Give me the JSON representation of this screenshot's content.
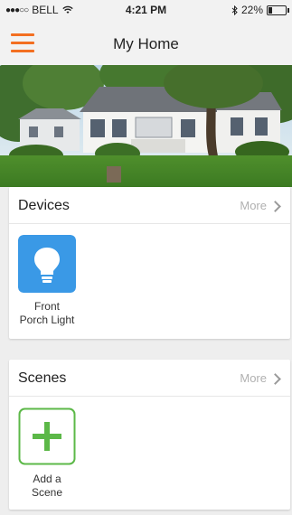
{
  "statusbar": {
    "carrier": "BELL",
    "time": "4:21 PM",
    "battery_text": "22%",
    "battery_level": 0.22
  },
  "navbar": {
    "title": "My Home"
  },
  "devices": {
    "title": "Devices",
    "more_label": "More",
    "items": [
      {
        "label_line1": "Front",
        "label_line2": "Porch Light",
        "icon": "lightbulb-icon",
        "color": "#3a99e6"
      }
    ]
  },
  "scenes": {
    "title": "Scenes",
    "more_label": "More",
    "add_label_line1": "Add a",
    "add_label_line2": "Scene",
    "add_color": "#5cb848"
  },
  "colors": {
    "accent": "#f36f21",
    "device_blue": "#3a99e6",
    "add_green": "#5cb848"
  }
}
